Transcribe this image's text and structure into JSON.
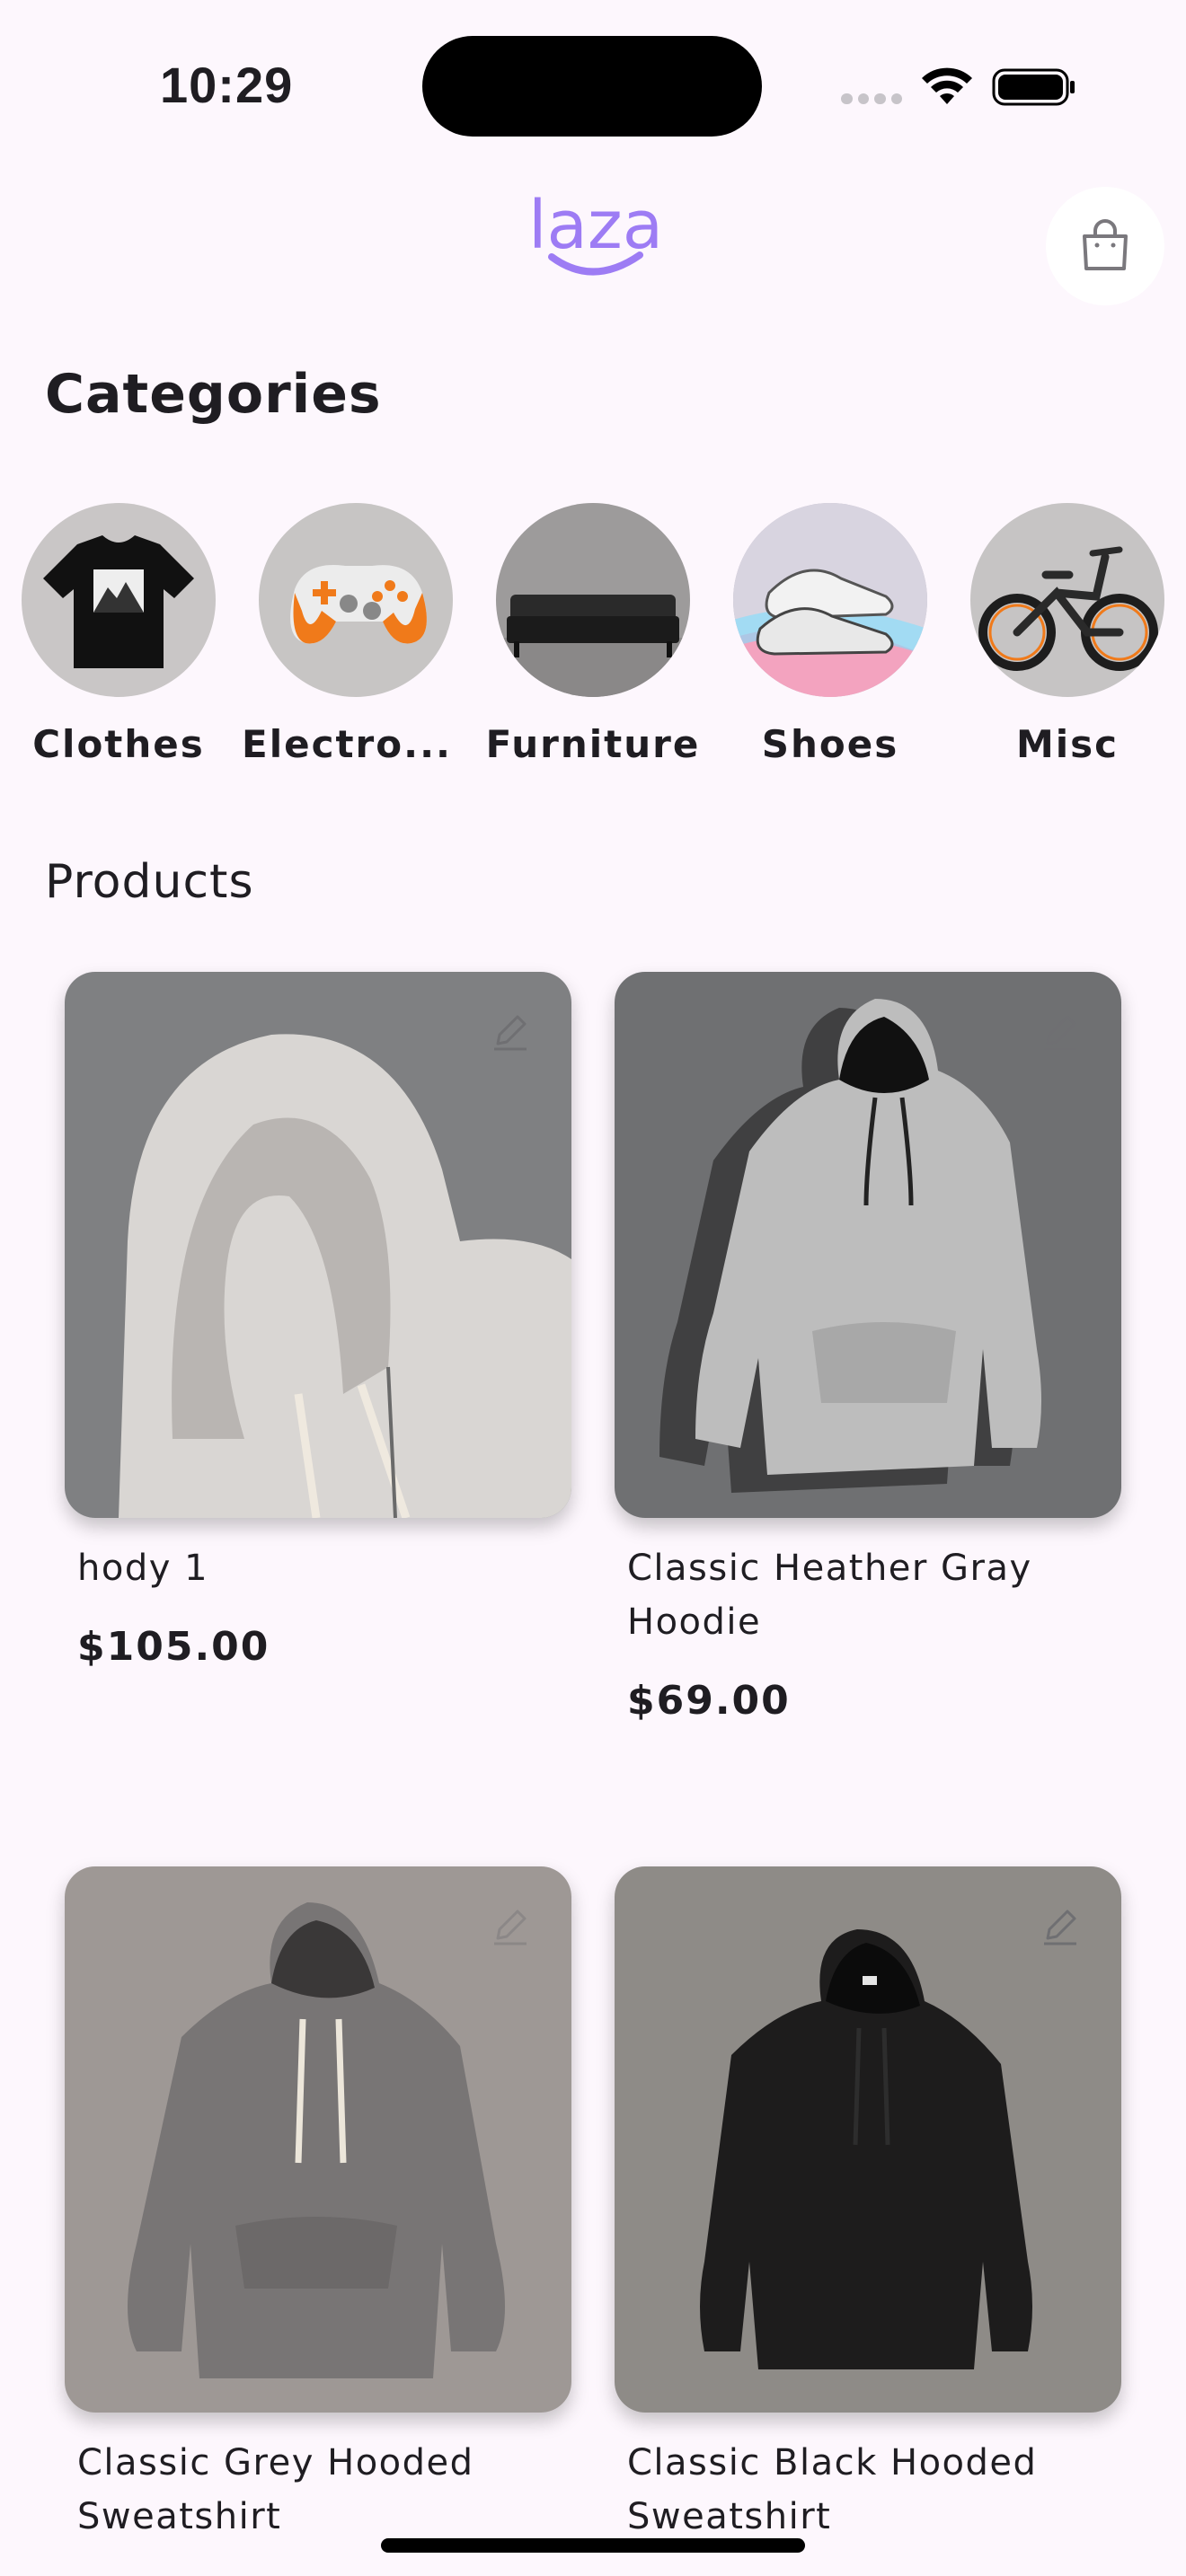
{
  "status_bar": {
    "time": "10:29"
  },
  "header": {
    "logo_text": "laza",
    "cart_icon": "shopping-bag-icon"
  },
  "categories": {
    "title": "Categories",
    "items": [
      {
        "label": "Clothes",
        "image": "tshirt-image"
      },
      {
        "label": "Electro...",
        "image": "gamepad-image"
      },
      {
        "label": "Furniture",
        "image": "sofa-image"
      },
      {
        "label": "Shoes",
        "image": "sneakers-image"
      },
      {
        "label": "Misc",
        "image": "ebike-image"
      }
    ]
  },
  "products": {
    "title": "Products",
    "items": [
      {
        "name_line1": "hody 1",
        "name_line2": "",
        "price": "$105.00"
      },
      {
        "name_line1": "Classic Heather Gray",
        "name_line2": "Hoodie",
        "price": "$69.00"
      },
      {
        "name_line1": "Classic Grey Hooded",
        "name_line2": "Sweatshirt",
        "price": ""
      },
      {
        "name_line1": "Classic Black Hooded",
        "name_line2": "Sweatshirt",
        "price": ""
      }
    ]
  },
  "colors": {
    "background": "#fdf7fd",
    "accent": "#9d7cf4"
  }
}
